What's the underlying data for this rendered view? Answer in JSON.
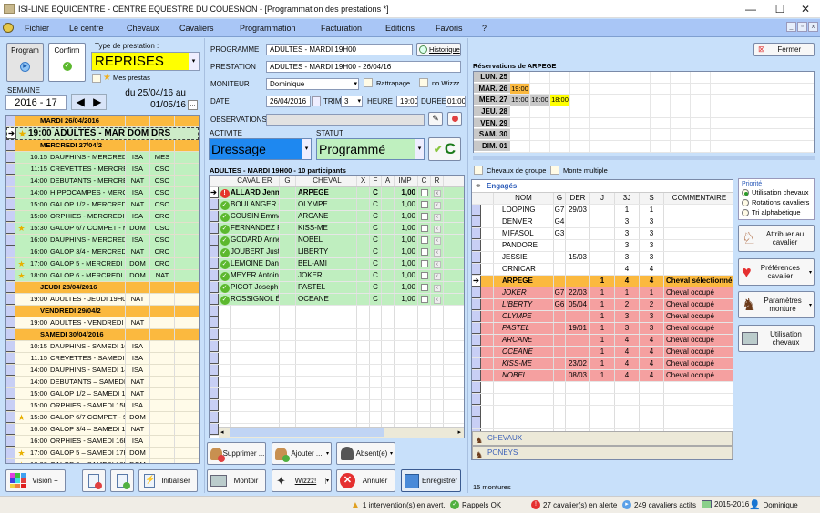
{
  "window": {
    "title": "ISI-LINE EQUICENTRE - CENTRE EQUESTRE DU COUESNON - [Programmation des prestations *]",
    "minimize": "—",
    "maximize": "☐",
    "close": "✕"
  },
  "menu": [
    "Fichier",
    "Le centre",
    "Chevaux",
    "Cavaliers",
    "Programmation",
    "Facturation",
    "Editions",
    "Favoris",
    "?"
  ],
  "left": {
    "program_label": "Program",
    "confirm_label": "Confirm",
    "type_label": "Type de prestation :",
    "type_value": "REPRISES",
    "mes_prestas": "Mes prestas",
    "semaine_label": "SEMAINE",
    "semaine_value": "2016 - 17",
    "range_line1": "du 25/04/16 au",
    "range_line2": "01/05/16",
    "range_btn": "...",
    "rows": [
      {
        "type": "day",
        "label": "MARDI 26/04/2016"
      },
      {
        "type": "current",
        "star": true,
        "label": "19:00 ADULTES - MAR DOM DRS"
      },
      {
        "type": "day",
        "label": "MERCREDI 27/04/2"
      },
      {
        "type": "green",
        "star": false,
        "time": "10:15",
        "name": "DAUPHINS - MERCREDI",
        "m1": "ISA",
        "m2": "MES"
      },
      {
        "type": "green",
        "star": false,
        "time": "11:15",
        "name": "CREVETTES - MERCREDI",
        "m1": "ISA",
        "m2": "CSO"
      },
      {
        "type": "green",
        "star": false,
        "time": "14:00",
        "name": "DEBUTANTS - MERCREDI",
        "m1": "NAT",
        "m2": "CSO"
      },
      {
        "type": "green",
        "star": false,
        "time": "14:00",
        "name": "HIPPOCAMPES - MERC",
        "m1": "ISA",
        "m2": "CSO"
      },
      {
        "type": "green",
        "star": false,
        "time": "15:00",
        "name": "GALOP 1/2 - MERCREDI",
        "m1": "NAT",
        "m2": "CSO"
      },
      {
        "type": "green",
        "star": false,
        "time": "15:00",
        "name": "ORPHIES - MERCREDI",
        "m1": "ISA",
        "m2": "CRO"
      },
      {
        "type": "green",
        "star": true,
        "time": "15:30",
        "name": "GALOP 6/7 COMPET - M",
        "m1": "DOM",
        "m2": "CSO"
      },
      {
        "type": "green",
        "star": false,
        "time": "16:00",
        "name": "DAUPHINS - MERCREDI",
        "m1": "ISA",
        "m2": "CSO"
      },
      {
        "type": "green",
        "star": false,
        "time": "16:00",
        "name": "GALOP 3/4 - MERCREDI",
        "m1": "NAT",
        "m2": "CRO"
      },
      {
        "type": "green",
        "star": true,
        "time": "17:00",
        "name": "GALOP 5 - MERCREDI 1",
        "m1": "DOM",
        "m2": "CRO"
      },
      {
        "type": "green",
        "star": true,
        "time": "18:00",
        "name": "GALOP 6 - MERCREDI 1",
        "m1": "DOM",
        "m2": "NAT"
      },
      {
        "type": "day",
        "label": "JEUDI 28/04/2016"
      },
      {
        "type": "plain",
        "star": false,
        "time": "19:00",
        "name": "ADULTES - JEUDI 19H0",
        "m1": "NAT",
        "m2": ""
      },
      {
        "type": "day",
        "label": "VENDREDI 29/04/2"
      },
      {
        "type": "plain",
        "star": false,
        "time": "19:00",
        "name": "ADULTES - VENDREDI",
        "m1": "NAT",
        "m2": ""
      },
      {
        "type": "day",
        "label": "SAMEDI 30/04/2016"
      },
      {
        "type": "plain",
        "star": false,
        "time": "10:15",
        "name": "DAUPHINS - SAMEDI 10",
        "m1": "ISA",
        "m2": ""
      },
      {
        "type": "plain",
        "star": false,
        "time": "11:15",
        "name": "CREVETTES - SAMEDI",
        "m1": "ISA",
        "m2": ""
      },
      {
        "type": "plain",
        "star": false,
        "time": "14:00",
        "name": "DAUPHINS - SAMEDI 14",
        "m1": "ISA",
        "m2": ""
      },
      {
        "type": "plain",
        "star": false,
        "time": "14:00",
        "name": "DEBUTANTS – SAMEDI",
        "m1": "NAT",
        "m2": ""
      },
      {
        "type": "plain",
        "star": false,
        "time": "15:00",
        "name": "GALOP 1/2 – SAMEDI 1",
        "m1": "NAT",
        "m2": ""
      },
      {
        "type": "plain",
        "star": false,
        "time": "15:00",
        "name": "ORPHIES - SAMEDI 15H",
        "m1": "ISA",
        "m2": ""
      },
      {
        "type": "plain",
        "star": true,
        "time": "15:30",
        "name": "GALOP 6/7 COMPET - S",
        "m1": "DOM",
        "m2": ""
      },
      {
        "type": "plain",
        "star": false,
        "time": "16:00",
        "name": "GALOP 3/4 – SAMEDI 1",
        "m1": "NAT",
        "m2": ""
      },
      {
        "type": "plain",
        "star": false,
        "time": "16:00",
        "name": "ORPHIES - SAMEDI 16H",
        "m1": "ISA",
        "m2": ""
      },
      {
        "type": "plain",
        "star": true,
        "time": "17:00",
        "name": "GALOP 5 – SAMEDI 17H",
        "m1": "DOM",
        "m2": ""
      },
      {
        "type": "plain",
        "star": true,
        "time": "18:00",
        "name": "GALOP 6 – SAMEDI 18H",
        "m1": "DOM",
        "m2": ""
      }
    ],
    "vision_label": "Vision +",
    "initialiser_label": "Initialiser"
  },
  "center": {
    "programme_label": "PROGRAMME",
    "programme_value": "ADULTES - MARDI 19H00",
    "historique_label": "Historique",
    "prestation_label": "PRESTATION",
    "prestation_value": "ADULTES - MARDI 19H00 - 26/04/16",
    "moniteur_label": "MONITEUR",
    "moniteur_value": "Dominique",
    "rattrapage_label": "Rattrapage",
    "nowizzz_label": "no Wizzz",
    "date_label": "DATE",
    "date_value": "26/04/2016",
    "trim_label": "TRIM",
    "trim_value": "3",
    "heure_label": "HEURE",
    "heure_value": "19:00",
    "duree_label": "DUREE",
    "duree_value": "01:00",
    "observations_label": "OBSERVATIONS",
    "observations_value": "",
    "activite_label": "ACTIVITE",
    "activite_value": "Dressage",
    "statut_label": "STATUT",
    "statut_value": "Programmé",
    "c_label": "C",
    "participants_title": "ADULTES - MARDI 19H00 - 10 participants",
    "columns": [
      "CAVALIER",
      "G",
      "CHEVAL",
      "X",
      "F",
      "A",
      "IMP",
      "C",
      "R"
    ],
    "participants": [
      {
        "status": "alert",
        "cavalier": "ALLARD Jennifer",
        "g": "",
        "cheval": "ARPEGE",
        "x": "",
        "f": "C",
        "a": "",
        "imp": "1,00",
        "selected": true
      },
      {
        "status": "ok",
        "cavalier": "BOULANGER Gilbert",
        "g": "",
        "cheval": "OLYMPE",
        "x": "",
        "f": "C",
        "a": "",
        "imp": "1,00"
      },
      {
        "status": "ok",
        "cavalier": "COUSIN Emmanuel",
        "g": "",
        "cheval": "ARCANE",
        "x": "",
        "f": "C",
        "a": "",
        "imp": "1,00"
      },
      {
        "status": "ok",
        "cavalier": "FERNANDEZ Franck",
        "g": "",
        "cheval": "KISS-ME",
        "x": "",
        "f": "C",
        "a": "",
        "imp": "1,00"
      },
      {
        "status": "ok",
        "cavalier": "GODARD Anne",
        "g": "",
        "cheval": "NOBEL",
        "x": "",
        "f": "C",
        "a": "",
        "imp": "1,00"
      },
      {
        "status": "ok",
        "cavalier": "JOUBERT Justine",
        "g": "",
        "cheval": "LIBERTY",
        "x": "",
        "f": "C",
        "a": "",
        "imp": "1,00"
      },
      {
        "status": "ok",
        "cavalier": "LEMOINE Danielle",
        "g": "",
        "cheval": "BEL-AMI",
        "x": "",
        "f": "C",
        "a": "",
        "imp": "1,00"
      },
      {
        "status": "ok",
        "cavalier": "MEYER Antoine",
        "g": "",
        "cheval": "JOKER",
        "x": "",
        "f": "C",
        "a": "",
        "imp": "1,00"
      },
      {
        "status": "ok",
        "cavalier": "PICOT Joseph",
        "g": "",
        "cheval": "PASTEL",
        "x": "",
        "f": "C",
        "a": "",
        "imp": "1,00"
      },
      {
        "status": "ok",
        "cavalier": "ROSSIGNOL Éric",
        "g": "",
        "cheval": "OCEANE",
        "x": "",
        "f": "C",
        "a": "",
        "imp": "1,00"
      }
    ],
    "supprimer_label": "Supprimer ...",
    "ajouter_label": "Ajouter ...",
    "absent_label": "Absent(e)",
    "montoir_label": "Montoir",
    "wizzz_label": "Wizzz!",
    "annuler_label": "Annuler",
    "enregistrer_label": "Enregistrer"
  },
  "right": {
    "fermer_label": "Fermer",
    "reservations_title": "Réservations de ARPEGE",
    "reservations": [
      {
        "day": "LUN. 25",
        "slots": []
      },
      {
        "day": "MAR. 26",
        "slots": [
          {
            "time": "19:00",
            "color": "#fbb93f"
          }
        ]
      },
      {
        "day": "MER. 27",
        "slots": [
          {
            "time": "15:00",
            "color": "#c8c8c8"
          },
          {
            "time": "16:00",
            "color": "#c8c8c8"
          },
          {
            "time": "18:00",
            "color": "#ffff00"
          }
        ]
      },
      {
        "day": "JEU. 28",
        "slots": []
      },
      {
        "day": "VEN. 29",
        "slots": []
      },
      {
        "day": "SAM. 30",
        "slots": []
      },
      {
        "day": "DIM. 01",
        "slots": []
      }
    ],
    "chevaux_groupe_label": "Chevaux de groupe",
    "monte_multiple_label": "Monte multiple",
    "engages_title": "Engagés",
    "columns": [
      "NOM",
      "G",
      "DER",
      "J",
      "3J",
      "S",
      "COMMENTAIRE"
    ],
    "horses": [
      {
        "kind": "free",
        "nom": "LOOPING",
        "g": "G7",
        "der": "29/03",
        "j": "",
        "j3": "1",
        "s": "1",
        "com": ""
      },
      {
        "kind": "free",
        "nom": "DENVER",
        "g": "G4",
        "der": "",
        "j": "",
        "j3": "3",
        "s": "3",
        "com": ""
      },
      {
        "kind": "free",
        "nom": "MIFASOL",
        "g": "G3",
        "der": "",
        "j": "",
        "j3": "3",
        "s": "3",
        "com": ""
      },
      {
        "kind": "free",
        "nom": "PANDORE",
        "g": "",
        "der": "",
        "j": "",
        "j3": "3",
        "s": "3",
        "com": ""
      },
      {
        "kind": "free",
        "nom": "JESSIE",
        "g": "",
        "der": "15/03",
        "j": "",
        "j3": "3",
        "s": "3",
        "com": ""
      },
      {
        "kind": "free",
        "nom": "ORNICAR",
        "g": "",
        "der": "",
        "j": "",
        "j3": "4",
        "s": "4",
        "com": ""
      },
      {
        "kind": "sel",
        "nom": "ARPEGE",
        "g": "",
        "der": "",
        "j": "1",
        "j3": "4",
        "s": "4",
        "com": "Cheval sélectionné"
      },
      {
        "kind": "busy",
        "nom": "JOKER",
        "g": "G7",
        "der": "22/03",
        "j": "1",
        "j3": "1",
        "s": "1",
        "com": "Cheval occupé"
      },
      {
        "kind": "busy",
        "nom": "LIBERTY",
        "g": "G6",
        "der": "05/04",
        "j": "1",
        "j3": "2",
        "s": "2",
        "com": "Cheval occupé"
      },
      {
        "kind": "busy",
        "nom": "OLYMPE",
        "g": "",
        "der": "",
        "j": "1",
        "j3": "3",
        "s": "3",
        "com": "Cheval occupé"
      },
      {
        "kind": "busy",
        "nom": "PASTEL",
        "g": "",
        "der": "19/01",
        "j": "1",
        "j3": "3",
        "s": "3",
        "com": "Cheval occupé"
      },
      {
        "kind": "busy",
        "nom": "ARCANE",
        "g": "",
        "der": "",
        "j": "1",
        "j3": "4",
        "s": "4",
        "com": "Cheval occupé"
      },
      {
        "kind": "busy",
        "nom": "OCEANE",
        "g": "",
        "der": "",
        "j": "1",
        "j3": "4",
        "s": "4",
        "com": "Cheval occupé"
      },
      {
        "kind": "busy",
        "nom": "KISS-ME",
        "g": "",
        "der": "23/02",
        "j": "1",
        "j3": "4",
        "s": "4",
        "com": "Cheval occupé"
      },
      {
        "kind": "busy",
        "nom": "NOBEL",
        "g": "",
        "der": "08/03",
        "j": "1",
        "j3": "4",
        "s": "4",
        "com": "Cheval occupé"
      }
    ],
    "chevaux_label": "CHEVAUX",
    "poneys_label": "PONEYS",
    "count_label": "15 montures",
    "priorite_title": "Priorité",
    "priorite_options": [
      "Utilisation chevaux",
      "Rotations cavaliers",
      "Tri alphabétique"
    ],
    "priorite_selected": 0,
    "attribuer_label": "Attribuer au cavalier",
    "preferences_label": "Préférences cavalier",
    "parametres_label": "Paramètres monture",
    "utilisation_label": "Utilisation chevaux"
  },
  "status": {
    "warn": "1 intervention(s) en avert.",
    "rappels": "Rappels OK",
    "alerte": "27 cavalier(s) en alerte",
    "actifs": "249 cavaliers actifs",
    "saison": "2015-2016",
    "user": "Dominique"
  },
  "colors": {
    "day_header": "#fbb93f",
    "green_row": "#bff0bf",
    "busy_row": "#f5a0a0",
    "activite": "#1e88f0",
    "statut": "#bff0bf",
    "type_prestation": "#ffff00"
  }
}
